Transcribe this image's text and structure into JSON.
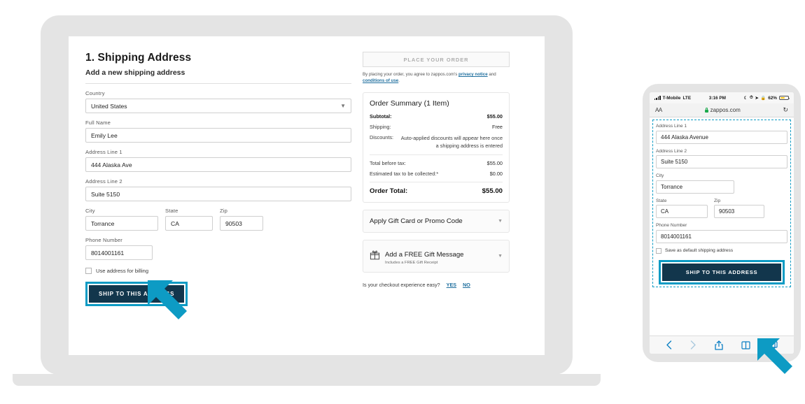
{
  "accent": "#0d9bc4",
  "navy": "#12364c",
  "link": "#1f6f9e",
  "desktop": {
    "step_title": "1. Shipping Address",
    "subtitle": "Add a new shipping address",
    "fields": {
      "country_label": "Country",
      "country_value": "United States",
      "fullname_label": "Full Name",
      "fullname_value": "Emily Lee",
      "address1_label": "Address Line 1",
      "address1_value": "444 Alaska Ave",
      "address2_label": "Address Line 2",
      "address2_value": "Suite 5150",
      "city_label": "City",
      "city_value": "Torrance",
      "state_label": "State",
      "state_value": "CA",
      "zip_label": "Zip",
      "zip_value": "90503",
      "phone_label": "Phone Number",
      "phone_value": "8014001161"
    },
    "billing_checkbox_label": "Use address for billing",
    "submit_label": "SHIP TO THIS ADDRESS"
  },
  "summary": {
    "place_order_label": "PLACE YOUR ORDER",
    "legal_prefix": "By placing your order, you agree to zappos.com's ",
    "legal_link1": "privacy notice",
    "legal_middle": " and ",
    "legal_link2": "conditions of use",
    "legal_suffix": ".",
    "title": "Order Summary (1 Item)",
    "lines": [
      {
        "label": "Subtotal:",
        "value": "$55.00",
        "bold": true
      },
      {
        "label": "Shipping:",
        "value": "Free",
        "bold": false
      },
      {
        "label": "Discounts:",
        "value": "Auto-applied discounts will appear here once a shipping address is entered",
        "bold": false
      },
      {
        "label": "Total before tax:",
        "value": "$55.00",
        "bold": false
      },
      {
        "label": "Estimated tax to be collected:*",
        "value": "$0.00",
        "bold": false
      }
    ],
    "total_label": "Order Total:",
    "total_value": "$55.00",
    "promo_label": "Apply Gift Card or Promo Code",
    "gift_label": "Add a FREE Gift Message",
    "gift_sub": "Includes a FREE Gift Receipt",
    "feedback_question": "Is your checkout experience easy?",
    "feedback_yes": "YES",
    "feedback_no": "NO"
  },
  "phone": {
    "status": {
      "carrier": "T-Mobile",
      "network": "LTE",
      "time": "3:16 PM",
      "battery": "62%"
    },
    "browser": {
      "text_size_label": "AA",
      "url": "zappos.com"
    },
    "fields": {
      "address1_label": "Address Line 1",
      "address1_value": "444 Alaska Avenue",
      "address2_label": "Address Line 2",
      "address2_value": "Suite 5150",
      "city_label": "City",
      "city_value": "Torrance",
      "state_label": "State",
      "state_value": "CA",
      "zip_label": "Zip",
      "zip_value": "90503",
      "phone_label": "Phone Number",
      "phone_value": "8014001161"
    },
    "default_checkbox_label": "Save as default shipping address",
    "submit_label": "SHIP TO THIS ADDRESS"
  }
}
